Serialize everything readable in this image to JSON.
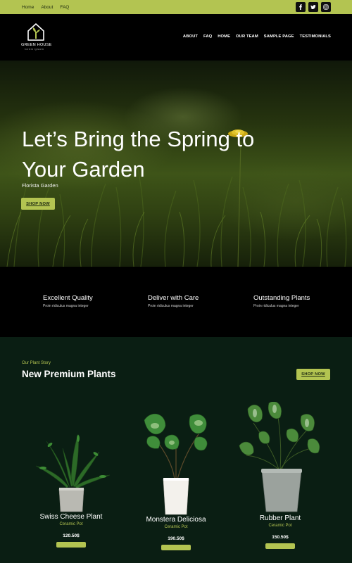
{
  "topbar": {
    "links": [
      "Home",
      "About",
      "FAQ"
    ],
    "socials": [
      "facebook-icon",
      "twitter-icon",
      "instagram-icon"
    ]
  },
  "header": {
    "logo": {
      "name": "GREEN HOUSE",
      "tagline": "lorem ipsum"
    },
    "nav": [
      "ABOUT",
      "FAQ",
      "HOME",
      "OUR TEAM",
      "SAMPLE PAGE",
      "TESTIMONIALS"
    ]
  },
  "hero": {
    "title": "Let’s Bring the Spring to Your Garden",
    "subtitle": "Florista Garden",
    "button": "SHOP NOW"
  },
  "features": [
    {
      "title": "Excellent Quality",
      "text": "Proin ridiculus magna integer"
    },
    {
      "title": "Deliver with Care",
      "text": "Proin ridiculus magna integer"
    },
    {
      "title": "Outstanding Plants",
      "text": "Proin ridiculus magna integer"
    }
  ],
  "products_section": {
    "eyebrow": "Our Plant Story",
    "title": "New Premium Plants",
    "button": "SHOP NOW",
    "items": [
      {
        "name": "Swiss Cheese Plant",
        "type": "Ceramic Pot",
        "price": "120.50$"
      },
      {
        "name": "Monstera Deliciosa",
        "type": "Ceramic Pot",
        "price": "190.50$"
      },
      {
        "name": "Rubber Plant",
        "type": "Ceramic Pot",
        "price": "150.50$"
      }
    ]
  },
  "colors": {
    "accent": "#b3c451",
    "section_bg": "#0a1e13",
    "header_bg": "#000000"
  }
}
